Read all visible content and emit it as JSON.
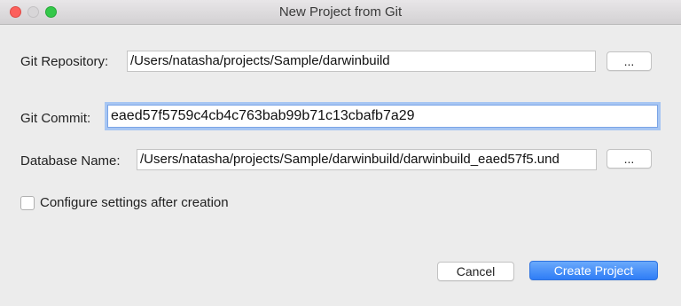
{
  "window": {
    "title": "New Project from Git"
  },
  "form": {
    "repository": {
      "label": "Git Repository:",
      "value": "/Users/natasha/projects/Sample/darwinbuild",
      "browse_label": "..."
    },
    "commit": {
      "label": "Git Commit:",
      "value": "eaed57f5759c4cb4c763bab99b71c13cbafb7a29"
    },
    "database": {
      "label": "Database Name:",
      "value": "/Users/natasha/projects/Sample/darwinbuild/darwinbuild_eaed57f5.und",
      "browse_label": "..."
    },
    "configure_checkbox": {
      "label": "Configure settings after creation",
      "checked": false
    }
  },
  "buttons": {
    "cancel_label": "Cancel",
    "create_label": "Create Project"
  },
  "colors": {
    "accent": "#2f7df6",
    "focus_ring": "#a7c6f3",
    "close": "#fc605c",
    "maximize": "#34c84a"
  }
}
